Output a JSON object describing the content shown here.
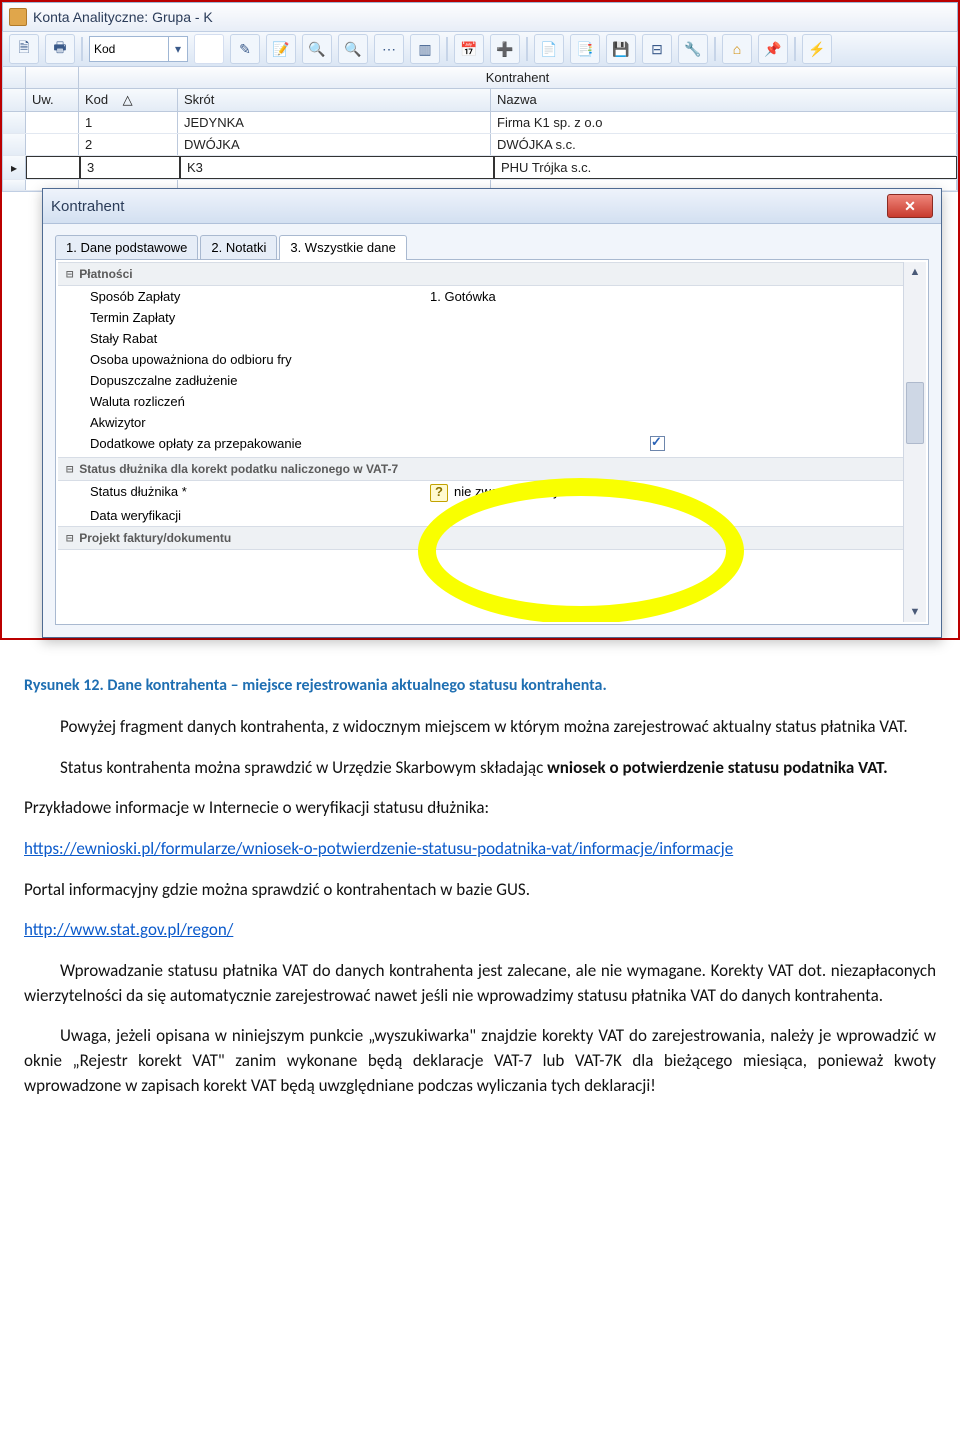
{
  "window": {
    "title": "Konta Analityczne: Grupa - K"
  },
  "toolbar": {
    "combo_value": "Kod"
  },
  "grid": {
    "band": "Kontrahent",
    "headers": {
      "uv": "Uw.",
      "kod": "Kod",
      "sort": "△",
      "skrot": "Skrót",
      "nazwa": "Nazwa"
    },
    "rows": [
      {
        "kod": "1",
        "skrot": "JEDYNKA",
        "nazwa": "Firma K1 sp. z o.o"
      },
      {
        "kod": "2",
        "skrot": "DWÓJKA",
        "nazwa": "DWÓJKA s.c."
      },
      {
        "kod": "3",
        "skrot": "K3",
        "nazwa": "PHU Trójka s.c."
      }
    ],
    "selmark": "▸"
  },
  "modal": {
    "title": "Kontrahent",
    "tabs": [
      "1. Dane podstawowe",
      "2. Notatki",
      "3. Wszystkie dane"
    ],
    "section_payments": "Płatności",
    "rows": {
      "sposob": {
        "label": "Sposób Zapłaty",
        "value": "1. Gotówka"
      },
      "termin": {
        "label": "Termin Zapłaty"
      },
      "rabat": {
        "label": "Stały Rabat"
      },
      "osoba": {
        "label": "Osoba upoważniona do odbioru fry"
      },
      "zadluzenie": {
        "label": "Dopuszczalne zadłużenie"
      },
      "waluta": {
        "label": "Waluta rozliczeń"
      },
      "akwizytor": {
        "label": "Akwizytor"
      },
      "przepak": {
        "label": "Dodatkowe opłaty za przepakowanie"
      }
    },
    "section_status": "Status dłużnika dla korekt podatku naliczonego w VAT-7",
    "status": {
      "label": "Status dłużnika *",
      "value": "nie zweryfikowany"
    },
    "data_wer": {
      "label": "Data weryfikacji"
    },
    "section_projekt": "Projekt faktury/dokumentu"
  },
  "doc": {
    "caption": "Rysunek 12. Dane kontrahenta – miejsce rejestrowania aktualnego statusu kontrahenta.",
    "p1": "Powyżej fragment danych kontrahenta, z widocznym miejscem w którym można zarejestrować aktualny status płatnika VAT.",
    "p2a": "Status kontrahenta można sprawdzić w Urzędzie Skarbowym składając ",
    "p2b": "wniosek o potwierdzenie statusu podatnika VAT.",
    "p3": "Przykładowe informacje w Internecie o weryfikacji statusu dłużnika:",
    "link1": "https://ewnioski.pl/formularze/wniosek-o-potwierdzenie-statusu-podatnika-vat/informacje/informacje",
    "p4": "Portal informacyjny gdzie można sprawdzić o kontrahentach w bazie GUS.",
    "link2": "http://www.stat.gov.pl/regon/",
    "p5": "Wprowadzanie statusu płatnika VAT do danych kontrahenta jest zalecane, ale nie wymagane. Korekty VAT dot. niezapłaconych wierzytelności da się automatycznie zarejestrować nawet jeśli nie wprowadzimy statusu płatnika VAT do danych kontrahenta.",
    "p6": "Uwaga, jeżeli opisana w niniejszym punkcie „wyszukiwarka\" znajdzie korekty VAT do zarejestrowania, należy je wprowadzić w oknie „Rejestr korekt VAT\" zanim wykonane będą deklaracje VAT-7 lub VAT-7K dla bieżącego miesiąca, ponieważ kwoty wprowadzone w zapisach korekt VAT będą uwzględniane podczas wyliczania tych deklaracji!"
  }
}
